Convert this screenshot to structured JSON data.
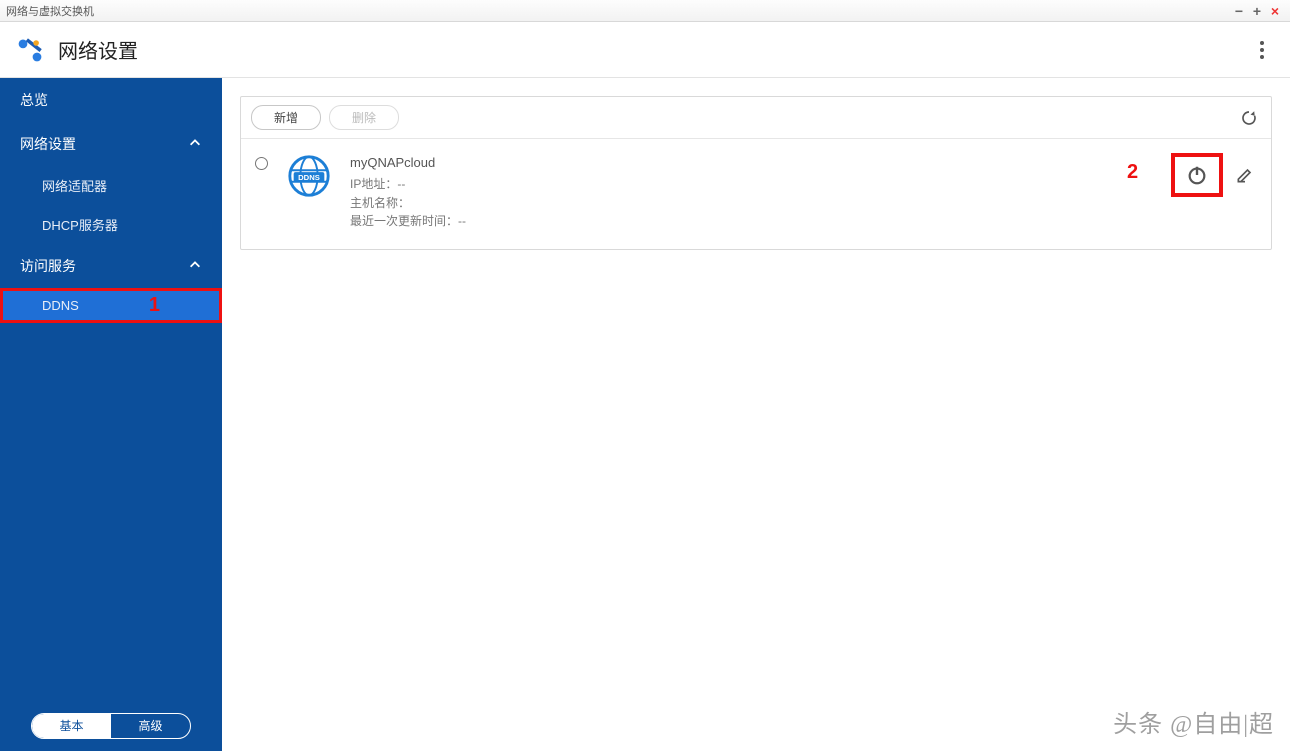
{
  "window": {
    "title": "网络与虚拟交换机"
  },
  "header": {
    "title": "网络设置"
  },
  "sidebar": {
    "overview": "总览",
    "network_settings": "网络设置",
    "adapters": "网络适配器",
    "dhcp": "DHCP服务器",
    "access_services": "访问服务",
    "ddns": "DDNS",
    "callout1": "1",
    "footer": {
      "basic": "基本",
      "advanced": "高级"
    }
  },
  "toolbar": {
    "add": "新增",
    "delete": "删除"
  },
  "entry": {
    "name": "myQNAPcloud",
    "ip_label": "IP地址：",
    "ip_value": "--",
    "host_label": "主机名称：",
    "host_value": "",
    "updated_label": "最近一次更新时间：",
    "updated_value": "--",
    "badge": "DDNS",
    "callout2": "2"
  },
  "watermark": "头条 @自由|超"
}
